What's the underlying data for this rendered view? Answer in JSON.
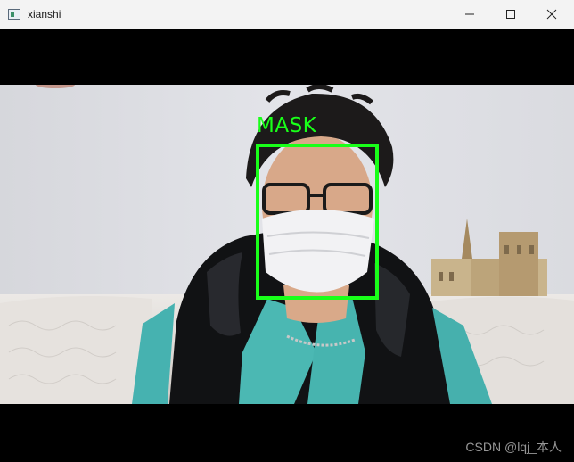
{
  "window": {
    "title": "xianshi",
    "icon": "app-window-icon",
    "controls": [
      "minimize-icon",
      "maximize-icon",
      "close-icon"
    ]
  },
  "detection": {
    "label": "MASK",
    "box_color": "#19ff19"
  },
  "watermark": "CSDN @lqj_本人"
}
